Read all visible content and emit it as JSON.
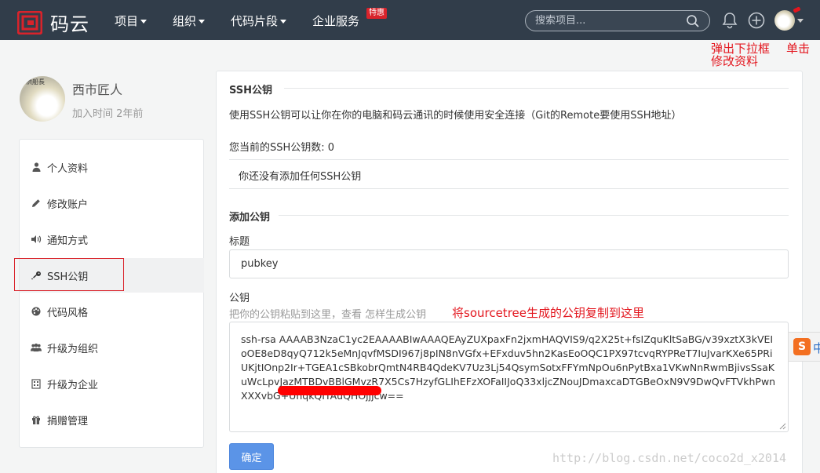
{
  "topbar": {
    "brand": "码云",
    "nav": [
      {
        "label": "项目",
        "dropdown": true
      },
      {
        "label": "组织",
        "dropdown": true
      },
      {
        "label": "代码片段",
        "dropdown": true
      },
      {
        "label": "企业服务",
        "badge": "特惠"
      }
    ],
    "search_placeholder": "搜索项目...",
    "colors": {
      "bar": "#313d4a",
      "badge": "#d9232b"
    }
  },
  "annotations": {
    "popup_note_line1": "弹出下拉框",
    "popup_note_line2": "修改资料",
    "click_note": "单击",
    "paste_note": "将sourcetree生成的公钥复制到这里"
  },
  "profile": {
    "avatar_text": "洪船長",
    "name": "西市匠人",
    "joined": "加入时间 2年前"
  },
  "sidebar": {
    "items": [
      {
        "label": "个人资料",
        "icon": "user-icon"
      },
      {
        "label": "修改账户",
        "icon": "pencil-icon"
      },
      {
        "label": "通知方式",
        "icon": "speaker-icon"
      },
      {
        "label": "SSH公钥",
        "icon": "key-icon",
        "active": true
      },
      {
        "label": "代码风格",
        "icon": "palette-icon"
      },
      {
        "label": "升级为组织",
        "icon": "group-icon"
      },
      {
        "label": "升级为企业",
        "icon": "building-icon"
      },
      {
        "label": "捐赠管理",
        "icon": "gift-icon"
      }
    ]
  },
  "ssh": {
    "title": "SSH公钥",
    "description": "使用SSH公钥可以让你在你的电脑和码云通讯的时候使用安全连接（Git的Remote要使用SSH地址）",
    "count_label": "您当前的SSH公钥数: 0",
    "empty_message": "你还没有添加任何SSH公钥"
  },
  "add_key": {
    "title": "添加公钥",
    "title_label": "标题",
    "title_value": "pubkey",
    "key_label": "公钥",
    "key_hint": "把你的公钥粘贴到这里，查看 怎样生成公钥",
    "key_value": "ssh-rsa AAAAB3NzaC1yc2EAAAABIwAAAQEAyZUXpaxFn2jxmHAQVIS9/q2X25t+fsIZquKltSaBG/v39xztX3kVEIoOE8eD8qyQ712k5eMnJqvfMSDI967j8pIN8nVGfx+EFxduv5hn2KasEoOQC1PX97tcvqRYPReT7IuJvarKXe65PRiUKjtIOnp2Ir+TGEA1cSBkobrQmtN4RB4QdeKV7Uz3Lj54QsymSotxFFYmNpOu6nPytBxa1VKwNnRwmBjivsSsaKuWcLpvJazMTBDvBBlGMvzR7X5Cs7HzyfGLIhEFzXOFaIIJoQ33xljcZNouJDmaxcaDTGBeOxN9V9DwQvFTVkhPwnXXXvbG+UhqkQITAuQHOjjjcw==",
    "confirm": "确定"
  },
  "watermark": "http://blog.csdn.net/coco2d_x2014",
  "ime": {
    "brand": "S",
    "mode": "中"
  }
}
